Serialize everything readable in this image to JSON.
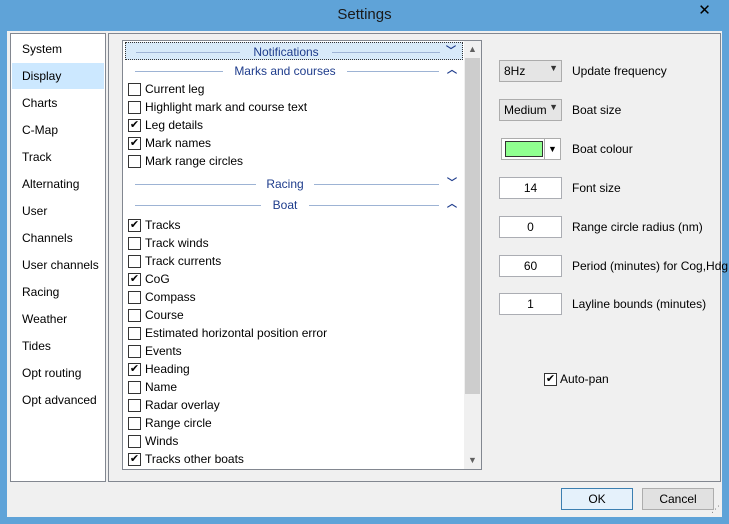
{
  "window": {
    "title": "Settings",
    "close_glyph": "✕"
  },
  "nav": {
    "items": [
      {
        "label": "System"
      },
      {
        "label": "Display"
      },
      {
        "label": "Charts"
      },
      {
        "label": "C-Map"
      },
      {
        "label": "Track"
      },
      {
        "label": "Alternating"
      },
      {
        "label": "User"
      },
      {
        "label": "Channels"
      },
      {
        "label": "User channels"
      },
      {
        "label": "Racing"
      },
      {
        "label": "Weather"
      },
      {
        "label": "Tides"
      },
      {
        "label": "Opt routing"
      },
      {
        "label": "Opt advanced"
      }
    ],
    "selected": "Display"
  },
  "list": {
    "sections": {
      "notifications": {
        "label": "Notifications",
        "state": "collapsed"
      },
      "marks": {
        "label": "Marks and courses",
        "state": "expanded"
      },
      "racing": {
        "label": "Racing",
        "state": "collapsed"
      },
      "boat": {
        "label": "Boat",
        "state": "expanded"
      }
    },
    "marks_items": [
      {
        "label": "Current leg",
        "checked": false
      },
      {
        "label": "Highlight mark and course text",
        "checked": false
      },
      {
        "label": "Leg details",
        "checked": true
      },
      {
        "label": "Mark names",
        "checked": true
      },
      {
        "label": "Mark range circles",
        "checked": false
      }
    ],
    "boat_items": [
      {
        "label": "Tracks",
        "checked": true
      },
      {
        "label": "Track winds",
        "checked": false
      },
      {
        "label": "Track currents",
        "checked": false
      },
      {
        "label": "CoG",
        "checked": true
      },
      {
        "label": "Compass",
        "checked": false
      },
      {
        "label": "Course",
        "checked": false
      },
      {
        "label": "Estimated horizontal position error",
        "checked": false
      },
      {
        "label": "Events",
        "checked": false
      },
      {
        "label": "Heading",
        "checked": true
      },
      {
        "label": "Name",
        "checked": false
      },
      {
        "label": "Radar overlay",
        "checked": false
      },
      {
        "label": "Range circle",
        "checked": false
      },
      {
        "label": "Winds",
        "checked": false
      },
      {
        "label": "Tracks other boats",
        "checked": true
      }
    ],
    "check_glyph": "✔"
  },
  "settings": {
    "update_frequency": {
      "label": "Update frequency",
      "value": "8Hz"
    },
    "boat_size": {
      "label": "Boat size",
      "value": "Medium"
    },
    "boat_colour": {
      "label": "Boat colour",
      "color": "#90ff90"
    },
    "font_size": {
      "label": "Font size",
      "value": "14"
    },
    "range_circle_radius": {
      "label": "Range circle radius (nm)",
      "value": "0"
    },
    "period": {
      "label": "Period (minutes) for Cog,Hdg",
      "value": "60"
    },
    "layline_bounds": {
      "label": "Layline bounds (minutes)",
      "value": "1"
    },
    "auto_pan": {
      "label": "Auto-pan",
      "checked": true
    }
  },
  "buttons": {
    "ok": "OK",
    "cancel": "Cancel"
  },
  "colors": {
    "titlebar": "#5fa3d8",
    "selection": "#cce8ff",
    "section_text": "#1e3c8c"
  }
}
